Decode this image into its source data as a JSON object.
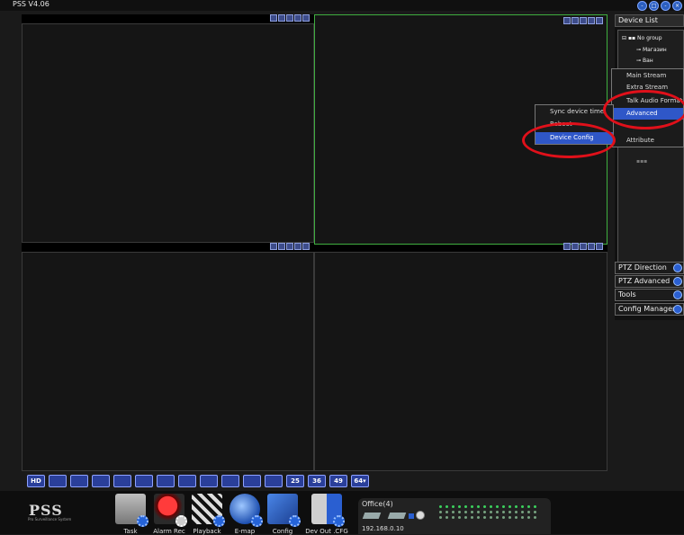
{
  "app": {
    "title": "PSS  V4.06"
  },
  "window_buttons": [
    "-",
    "□",
    "-",
    "×"
  ],
  "sidebar": {
    "device_list_label": "Device List",
    "tree": {
      "group": "No group",
      "device1": "Магазин",
      "device2": "Ван"
    },
    "sections": [
      "PTZ Direction",
      "PTZ Advanced",
      "Tools",
      "Config Manager"
    ]
  },
  "context_menu_right": {
    "items": [
      "Main Stream",
      "Extra Stream",
      "Talk Audio Format",
      "Advanced",
      "Attribute"
    ]
  },
  "context_menu_left": {
    "items": [
      "Sync device time",
      "Reboot",
      "Device Config"
    ]
  },
  "layout_buttons": [
    "HD",
    "",
    "",
    "",
    "",
    "",
    "",
    "",
    "",
    "",
    "",
    "",
    "25",
    "36",
    "49",
    "64▾"
  ],
  "bottom_tools": [
    "Task",
    "Alarm Rec",
    "Playback",
    "E-map",
    "Config",
    "Dev Out .CFG"
  ],
  "brand": {
    "name": "PSS",
    "subtitle": "Pro Surveillance System"
  },
  "office": {
    "title": "Office(4)",
    "ip": "192.168.0.10"
  },
  "colors": {
    "accent": "#2f57c8",
    "active_pane": "#3fae3f",
    "annotation": "#e0101a"
  }
}
